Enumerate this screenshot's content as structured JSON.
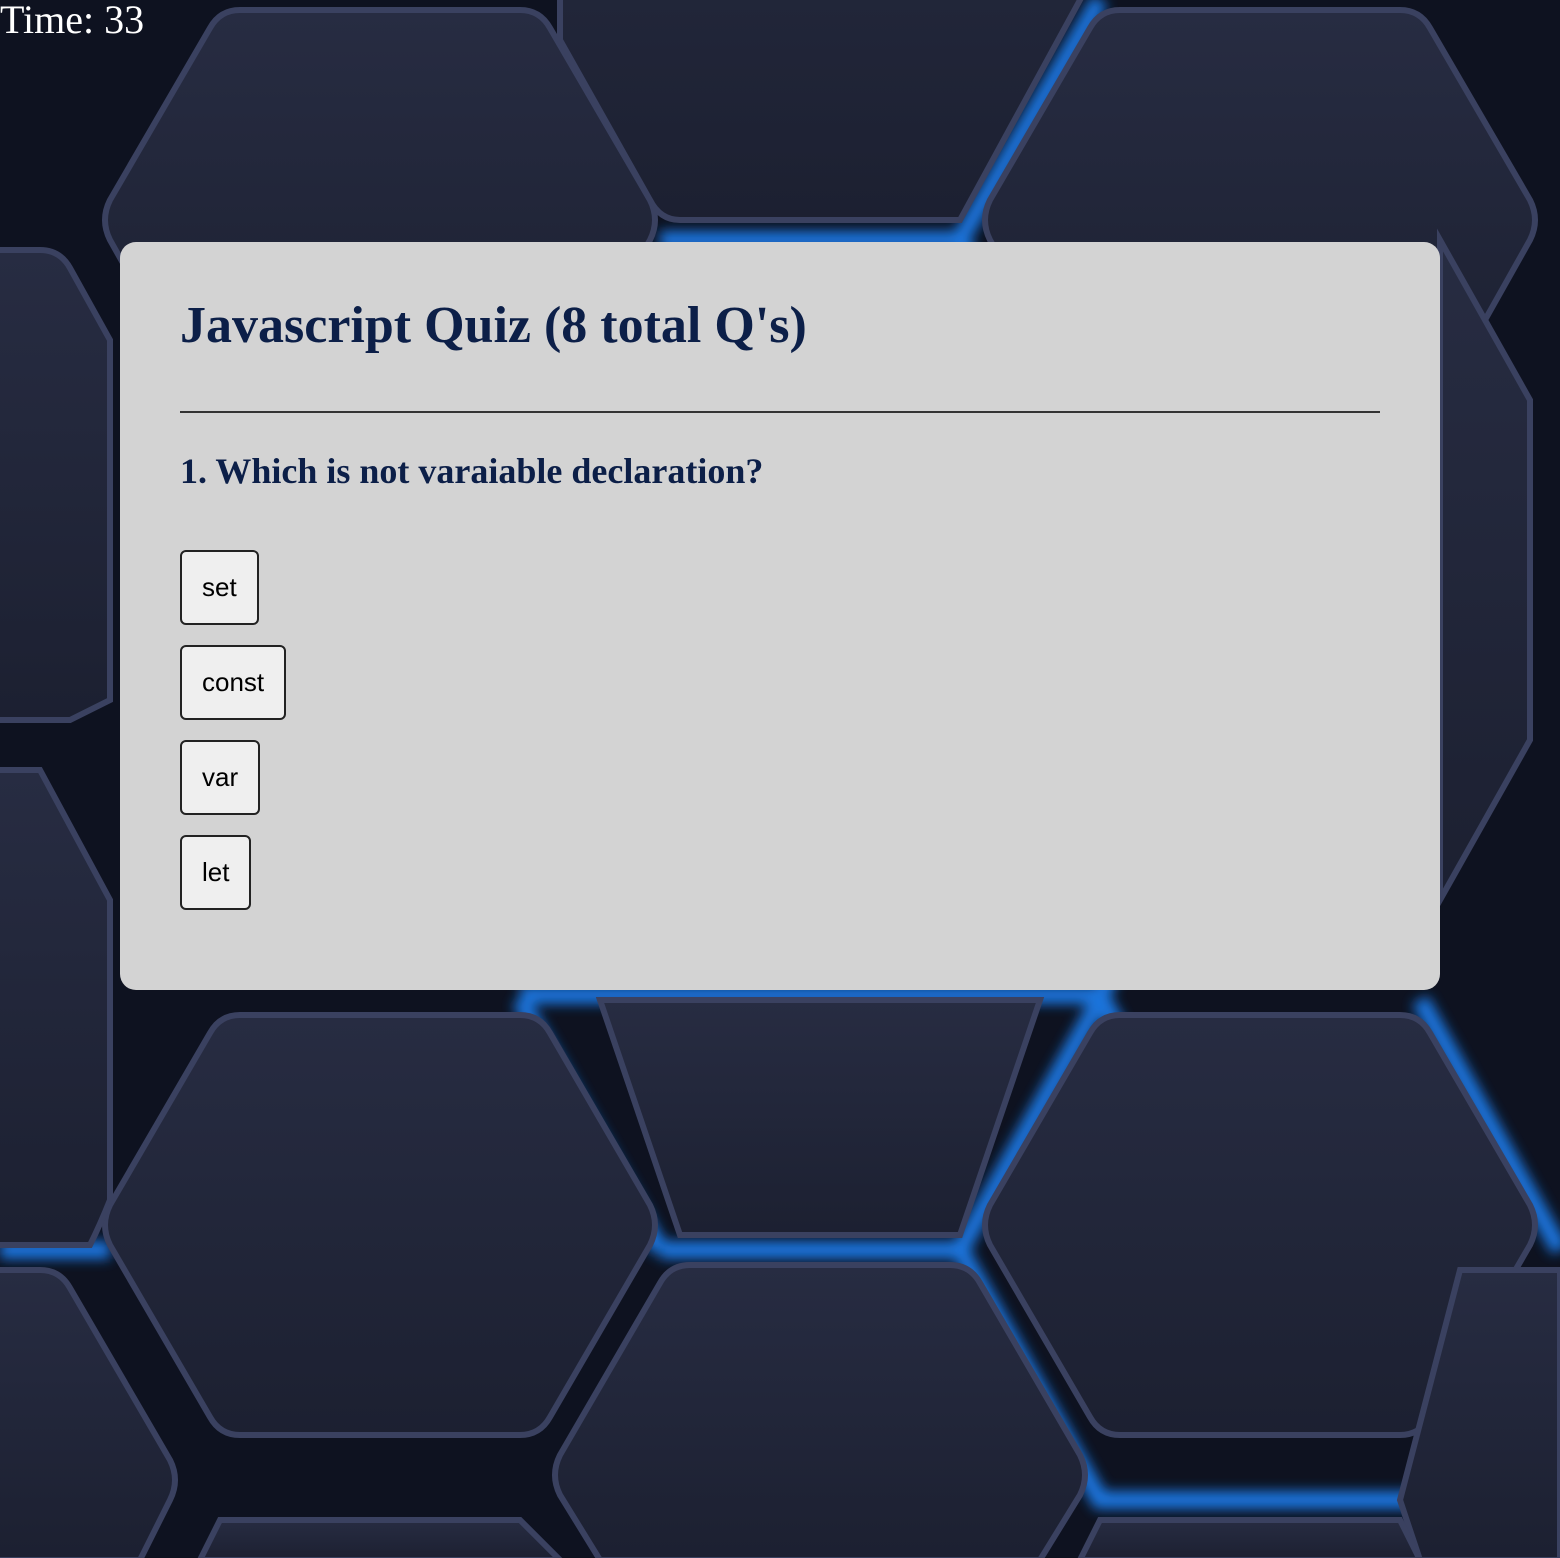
{
  "timer": {
    "label": "Time: 33"
  },
  "quiz": {
    "title": "Javascript Quiz (8 total Q's)",
    "question": "1. Which is not varaiable declaration?",
    "answers": [
      {
        "label": "set"
      },
      {
        "label": "const"
      },
      {
        "label": "var"
      },
      {
        "label": "let"
      }
    ]
  },
  "colors": {
    "card_background": "#d3d3d3",
    "heading_text": "#0c1f48",
    "timer_text": "#ffffff",
    "background_dark": "#1e2233",
    "background_glow": "#1a7ff0"
  },
  "background": {
    "icon": "hexagon-pattern"
  }
}
